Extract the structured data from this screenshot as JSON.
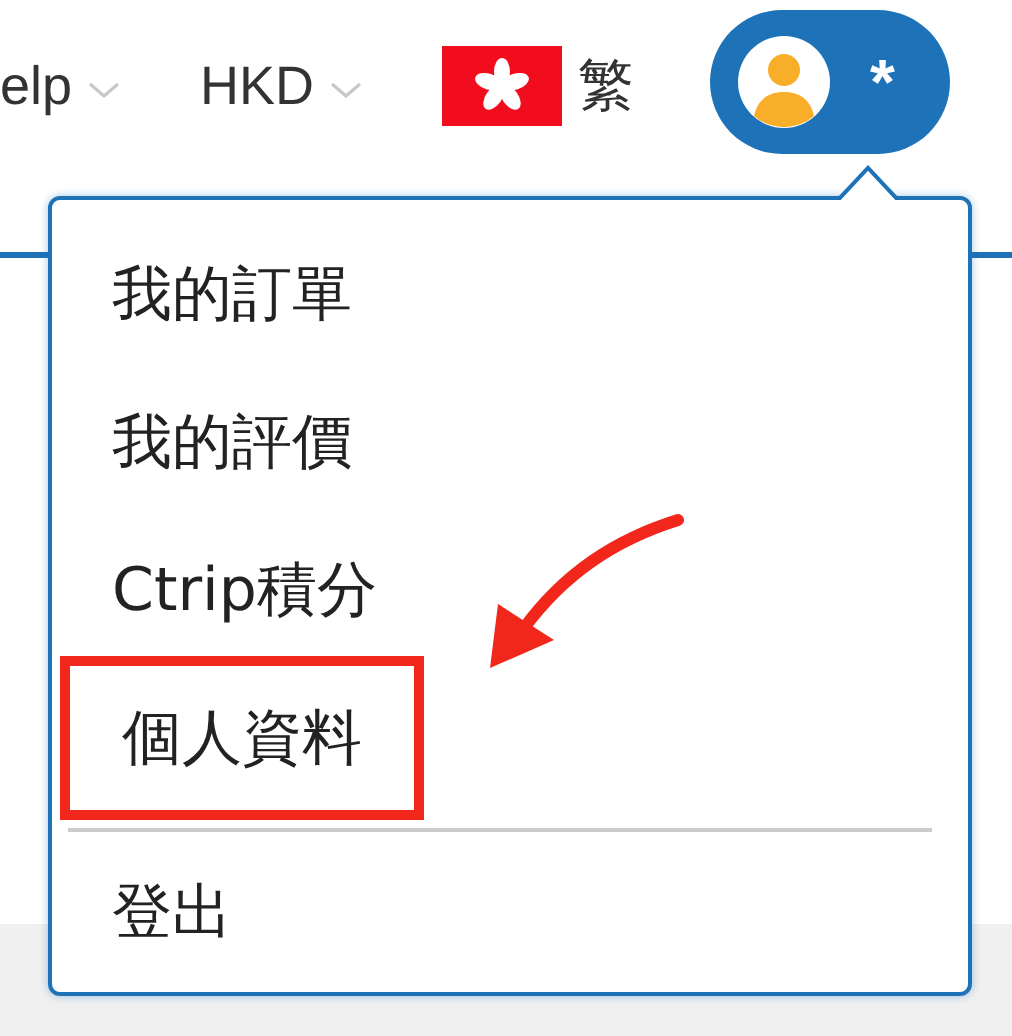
{
  "top_nav": [
    {
      "kind": "dropdown",
      "label": "elp"
    },
    {
      "kind": "dropdown",
      "label": "HKD"
    },
    {
      "kind": "language",
      "label": "繁"
    }
  ],
  "account_button": {
    "label": "*"
  },
  "account_menu": {
    "items": [
      {
        "label": "我的訂單",
        "highlighted": false
      },
      {
        "label": "我的評價",
        "highlighted": false
      },
      {
        "label": "Ctrip積分",
        "highlighted": false
      },
      {
        "label": "個人資料",
        "highlighted": true
      }
    ],
    "footer_items": [
      {
        "label": "登出"
      }
    ]
  }
}
